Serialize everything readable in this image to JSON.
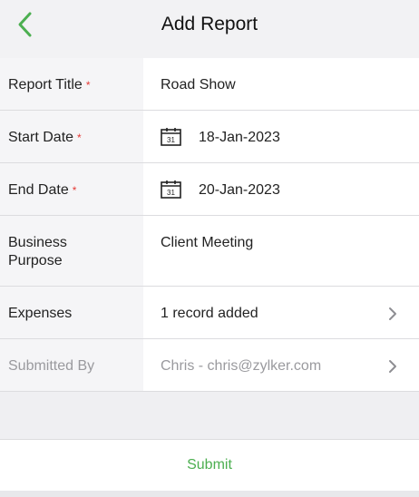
{
  "header": {
    "title": "Add Report",
    "back_icon": "back-arrow-icon"
  },
  "form": {
    "required_marker": "*",
    "calendar_day": "31",
    "report_title": {
      "label": "Report Title",
      "value": "Road Show",
      "required": true
    },
    "start_date": {
      "label": "Start Date",
      "value": "18-Jan-2023",
      "required": true,
      "icon": "calendar-icon"
    },
    "end_date": {
      "label": "End Date",
      "value": "20-Jan-2023",
      "required": true,
      "icon": "calendar-icon"
    },
    "business_purpose": {
      "label_line1": "Business",
      "label_line2": "Purpose",
      "value": "Client Meeting"
    },
    "expenses": {
      "label": "Expenses",
      "value": "1 record added",
      "icon": "chevron-right-icon"
    },
    "submitted_by": {
      "label": "Submitted By",
      "value": "Chris - chris@zylker.com",
      "icon": "chevron-right-icon"
    }
  },
  "footer": {
    "submit_label": "Submit"
  },
  "colors": {
    "accent": "#4caf50",
    "required": "#e53935",
    "muted_text": "#9a9a9e"
  }
}
